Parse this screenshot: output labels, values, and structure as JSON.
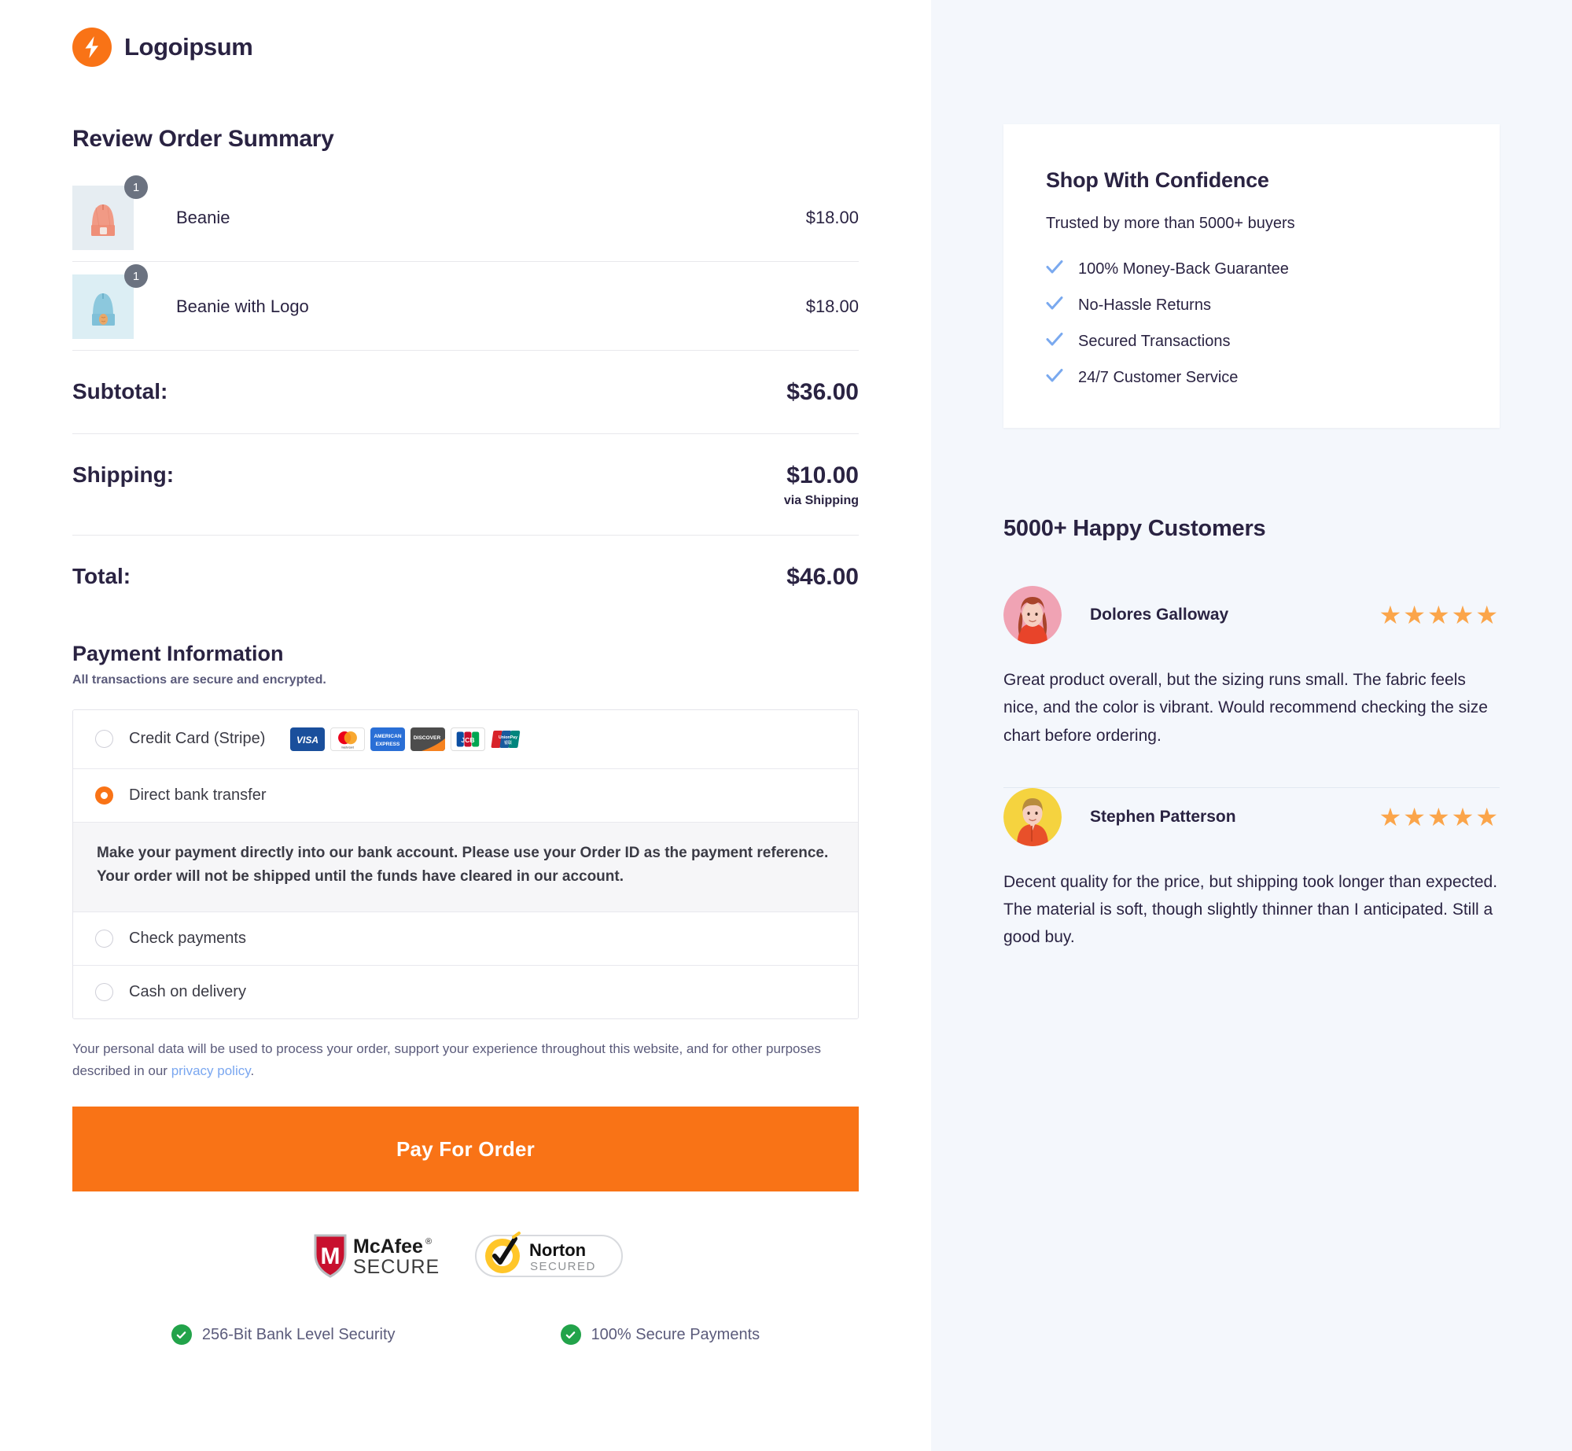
{
  "brand": {
    "name": "Logoipsum",
    "logo_icon": "lightning-bolt-icon",
    "accent_color": "#f97316"
  },
  "order_summary": {
    "title": "Review Order Summary",
    "items": [
      {
        "name": "Beanie",
        "price": "$18.00",
        "qty": "1",
        "thumb_color": "#ef9480",
        "thumb_bg": "#e6edf2"
      },
      {
        "name": "Beanie with Logo",
        "price": "$18.00",
        "qty": "1",
        "thumb_color": "#88c6dd",
        "thumb_bg": "#dceef4"
      }
    ],
    "subtotal_label": "Subtotal:",
    "subtotal_value": "$36.00",
    "shipping_label": "Shipping:",
    "shipping_value": "$10.00",
    "shipping_note": "via Shipping",
    "total_label": "Total:",
    "total_value": "$46.00"
  },
  "payment": {
    "title": "Payment Information",
    "subtitle": "All transactions are secure and encrypted.",
    "options": [
      {
        "label": "Credit Card (Stripe)",
        "selected": false,
        "has_cards": true
      },
      {
        "label": "Direct bank transfer",
        "selected": true,
        "has_cards": false
      },
      {
        "label": "Check payments",
        "selected": false,
        "has_cards": false
      },
      {
        "label": "Cash on delivery",
        "selected": false,
        "has_cards": false
      }
    ],
    "card_brands": [
      "visa",
      "mastercard",
      "american-express",
      "discover",
      "jcb",
      "unionpay"
    ],
    "bank_note": "Make your payment directly into our bank account. Please use your Order ID as the payment reference. Your order will not be shipped until the funds have cleared in our account.",
    "privacy_text_before": "Your personal data will be used to process your order, support your experience throughout this website, and for other purposes described in our ",
    "privacy_link": "privacy policy",
    "privacy_text_after": ".",
    "pay_button": "Pay For Order"
  },
  "seals": [
    {
      "name": "McAfee SECURE",
      "line1": "McAfee",
      "line2": "SECURE"
    },
    {
      "name": "Norton SECURED",
      "line1": "Norton",
      "line2": "SECURED"
    }
  ],
  "trust": [
    {
      "label": "256-Bit Bank Level Security",
      "icon": "check-circle-icon"
    },
    {
      "label": "100% Secure Payments",
      "icon": "check-circle-icon"
    }
  ],
  "confidence": {
    "title": "Shop With Confidence",
    "subtitle": "Trusted by more than 5000+ buyers",
    "items": [
      "100% Money-Back Guarantee",
      "No-Hassle Returns",
      "Secured Transactions",
      "24/7 Customer Service"
    ],
    "check_color": "#7aa9ef"
  },
  "testimonials": {
    "title": "5000+ Happy Customers",
    "star_color": "#fba54a",
    "reviews": [
      {
        "name": "Dolores Galloway",
        "stars": "★★★★★",
        "rating": 5,
        "text": "Great product overall, but the sizing runs small. The fabric feels nice, and the color is vibrant. Would recommend checking the size chart before ordering.",
        "avatar_bg": "#f0a3b4",
        "avatar_hair": "#a8442a",
        "avatar_shirt": "#e8442a"
      },
      {
        "name": "Stephen Patterson",
        "stars": "★★★★★",
        "rating": 5,
        "text": "Decent quality for the price, but shipping took longer than expected. The material is soft, though slightly thinner than I anticipated. Still a good buy.",
        "avatar_bg": "#f5d33f",
        "avatar_hair": "#b88c3e",
        "avatar_shirt": "#e8502a"
      }
    ]
  }
}
